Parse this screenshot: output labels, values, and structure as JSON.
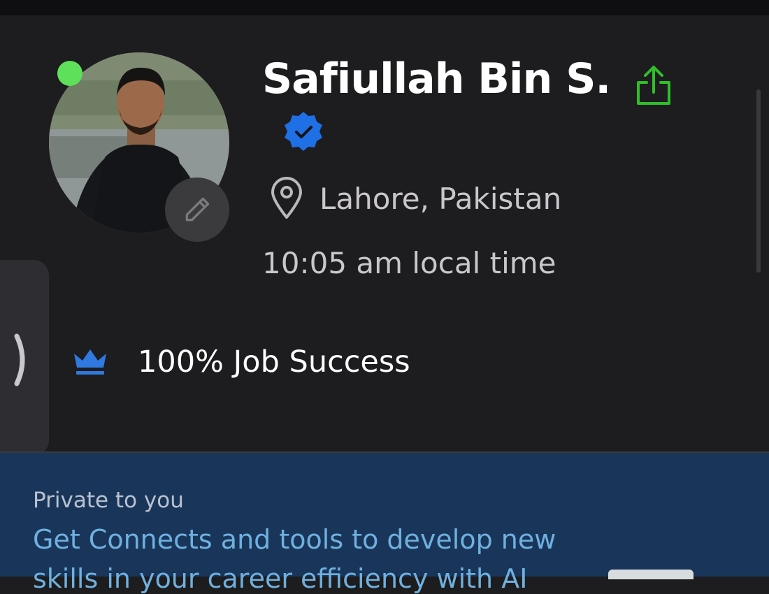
{
  "profile": {
    "name": "Safiullah Bin S.",
    "location": "Lahore, Pakistan",
    "local_time": "10:05 am local time",
    "online_status": "online",
    "verified": true,
    "job_success": "100% Job Success"
  },
  "private_panel": {
    "label": "Private to you",
    "link_line_1": "Get Connects and tools to develop new",
    "link_line_2": "skills in your career efficiency with AI"
  },
  "colors": {
    "background": "#1d1c1e",
    "online_green": "#5fe05a",
    "share_green": "#2fbf2a",
    "verified_blue": "#1f6fe5",
    "crown_blue": "#2f79e0",
    "panel_blue": "#19365a",
    "link_blue": "#6fb0df"
  },
  "icons": {
    "share": "share-icon",
    "verified": "verified-badge-icon",
    "location": "location-pin-icon",
    "edit": "pencil-icon",
    "expand": "chevron-right-icon",
    "job_success": "crown-icon"
  }
}
